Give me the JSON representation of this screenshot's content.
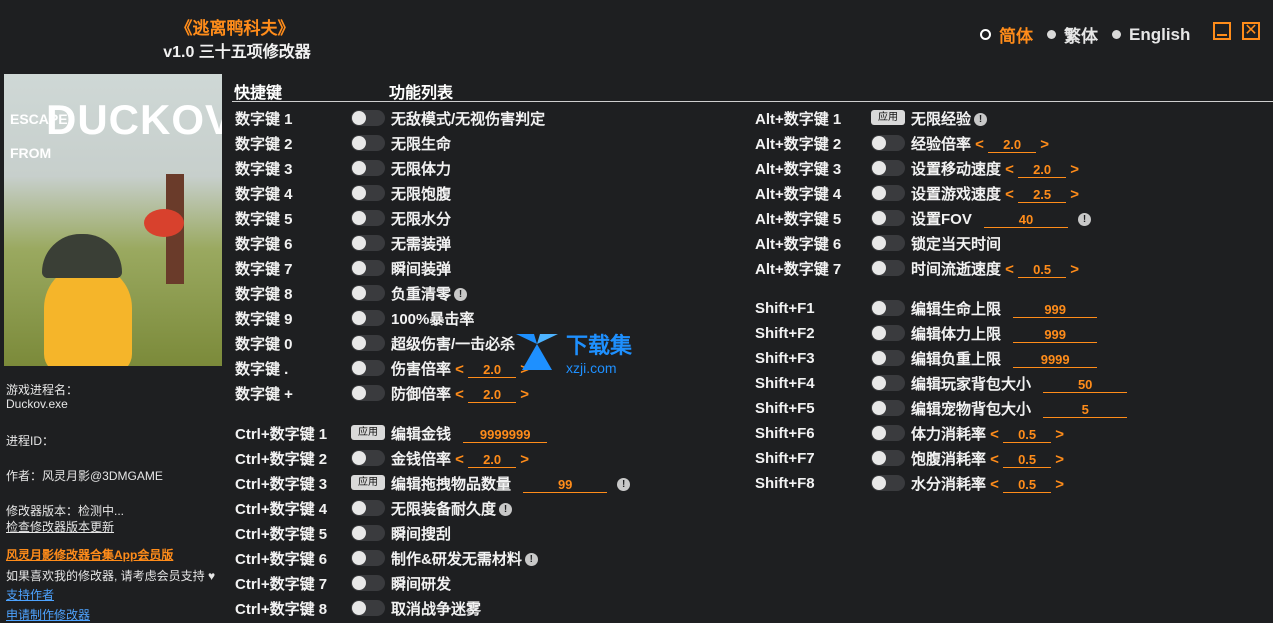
{
  "header": {
    "title": "《逃离鸭科夫》",
    "subtitle": "v1.0 三十五项修改器"
  },
  "languages": [
    {
      "label": "简体",
      "selected": true
    },
    {
      "label": "繁体",
      "selected": false
    },
    {
      "label": "English",
      "selected": false
    }
  ],
  "window": {
    "close_label": "✕"
  },
  "cover": {
    "line1": "ESCAPE FROM",
    "line2": "DUCKOV"
  },
  "sidebar": {
    "process_name_label": "游戏进程名：",
    "process_name": "Duckov.exe",
    "process_id_label": "进程ID：",
    "author": "作者：风灵月影@3DMGAME",
    "version": "修改器版本：检测中...",
    "check_update": "检查修改器版本更新",
    "app_link": "风灵月影修改器合集App会员版",
    "support_text": "如果喜欢我的修改器, 请考虑会员支持",
    "support_author": "支持作者",
    "request": "申请制作修改器"
  },
  "columns": {
    "hotkey": "快捷键",
    "features": "功能列表"
  },
  "watermark": {
    "cn": "下载集",
    "url": "xzji.com"
  },
  "left_rows": [
    {
      "key": "数字键 1",
      "label": "无敌模式/无视伤害判定"
    },
    {
      "key": "数字键 2",
      "label": "无限生命"
    },
    {
      "key": "数字键 3",
      "label": "无限体力"
    },
    {
      "key": "数字键 4",
      "label": "无限饱腹"
    },
    {
      "key": "数字键 5",
      "label": "无限水分"
    },
    {
      "key": "数字键 6",
      "label": "无需装弹"
    },
    {
      "key": "数字键 7",
      "label": "瞬间装弹"
    },
    {
      "key": "数字键 8",
      "label": "负重清零"
    },
    {
      "key": "数字键 9",
      "label": "100%暴击率"
    },
    {
      "key": "数字键 0",
      "label": "超级伤害/一击必杀"
    },
    {
      "key": "数字键 .",
      "label": "伤害倍率",
      "value": "2.0"
    },
    {
      "key": "数字键 +",
      "label": "防御倍率",
      "value": "2.0"
    },
    {
      "key": "Ctrl+数字键 1",
      "label": "编辑金钱",
      "value": "9999999",
      "apply": "应用"
    },
    {
      "key": "Ctrl+数字键 2",
      "label": "金钱倍率",
      "value": "2.0"
    },
    {
      "key": "Ctrl+数字键 3",
      "label": "编辑拖拽物品数量",
      "value": "99",
      "apply": "应用"
    },
    {
      "key": "Ctrl+数字键 4",
      "label": "无限装备耐久度"
    },
    {
      "key": "Ctrl+数字键 5",
      "label": "瞬间搜刮"
    },
    {
      "key": "Ctrl+数字键 6",
      "label": "制作&研发无需材料"
    },
    {
      "key": "Ctrl+数字键 7",
      "label": "瞬间研发"
    },
    {
      "key": "Ctrl+数字键 8",
      "label": "取消战争迷雾"
    }
  ],
  "right_rows": [
    {
      "key": "Alt+数字键 1",
      "label": "无限经验",
      "apply": "应用"
    },
    {
      "key": "Alt+数字键 2",
      "label": "经验倍率",
      "value": "2.0"
    },
    {
      "key": "Alt+数字键 3",
      "label": "设置移动速度",
      "value": "2.0"
    },
    {
      "key": "Alt+数字键 4",
      "label": "设置游戏速度",
      "value": "2.5"
    },
    {
      "key": "Alt+数字键 5",
      "label": "设置FOV",
      "value": "40"
    },
    {
      "key": "Alt+数字键 6",
      "label": "锁定当天时间"
    },
    {
      "key": "Alt+数字键 7",
      "label": "时间流逝速度",
      "value": "0.5"
    },
    {
      "key": "Shift+F1",
      "label": "编辑生命上限",
      "value": "999"
    },
    {
      "key": "Shift+F2",
      "label": "编辑体力上限",
      "value": "999"
    },
    {
      "key": "Shift+F3",
      "label": "编辑负重上限",
      "value": "9999"
    },
    {
      "key": "Shift+F4",
      "label": "编辑玩家背包大小",
      "value": "50"
    },
    {
      "key": "Shift+F5",
      "label": "编辑宠物背包大小",
      "value": "5"
    },
    {
      "key": "Shift+F6",
      "label": "体力消耗率",
      "value": "0.5"
    },
    {
      "key": "Shift+F7",
      "label": "饱腹消耗率",
      "value": "0.5"
    },
    {
      "key": "Shift+F8",
      "label": "水分消耗率",
      "value": "0.5"
    }
  ]
}
